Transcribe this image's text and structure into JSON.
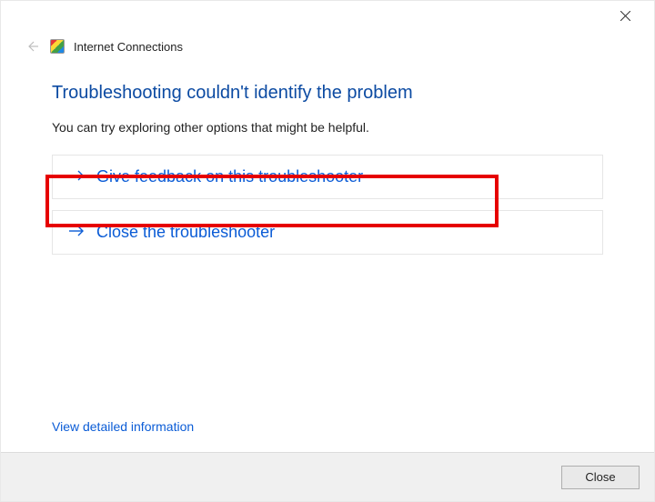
{
  "header": {
    "title": "Internet Connections"
  },
  "main": {
    "heading": "Troubleshooting couldn't identify the problem",
    "subtext": "You can try exploring other options that might be helpful.",
    "options": [
      {
        "label": "Give feedback on this troubleshooter"
      },
      {
        "label": "Close the troubleshooter"
      }
    ],
    "detailed_link": "View detailed information"
  },
  "footer": {
    "close_label": "Close"
  }
}
